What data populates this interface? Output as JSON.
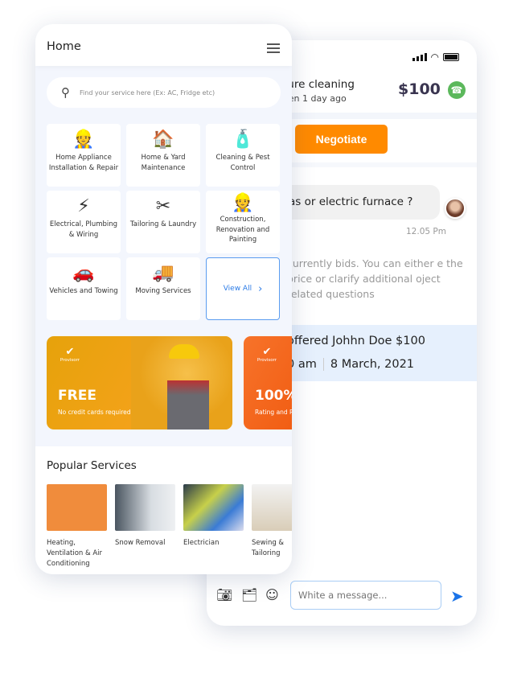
{
  "chat": {
    "job_title": "ture  cleaning",
    "last_seen": "een 1 day ago",
    "price": "$100",
    "negotiate_label": "Negotiate",
    "message": "as or electric furnace ?",
    "message_time": "12.05 Pm",
    "system_text": "currently bids. You can either e the price or clarify additional oject related questions",
    "offer_text": "offered Johhn Doe $100",
    "offer_time": "0 am",
    "offer_date": "8 March, 2021",
    "input_placeholder": "White a message...",
    "colors": {
      "accent": "#ff8a00",
      "call": "#5cb85c",
      "send": "#1a73e8",
      "offer_bg": "#e6f0fd"
    }
  },
  "home": {
    "title": "Home",
    "search_placeholder": "Find your service here (Ex: AC, Fridge etc)",
    "categories": [
      {
        "label": "Home Appliance Installation & Repair",
        "icon": "repairman-icon"
      },
      {
        "label": "Home & Yard Maintenance",
        "icon": "house-icon"
      },
      {
        "label": "Cleaning & Pest Control",
        "icon": "sprayer-icon"
      },
      {
        "label": "Electrical, Plumbing & Wiring",
        "icon": "electrician-icon"
      },
      {
        "label": "Tailoring & Laundry",
        "icon": "tailor-icon"
      },
      {
        "label": "Construction, Renovation and  Painting",
        "icon": "builder-icon"
      },
      {
        "label": "Vehicles and Towing",
        "icon": "car-wash-icon"
      },
      {
        "label": "Moving Services",
        "icon": "moving-truck-icon"
      }
    ],
    "view_all": "View All",
    "banners": [
      {
        "brand": "Provisorr",
        "headline": "FREE",
        "sub": "No credit cards required"
      },
      {
        "brand": "Provisorr",
        "headline": "100%",
        "sub": "Rating and R"
      }
    ],
    "popular_title": "Popular Services",
    "popular": [
      {
        "label": "Heating, Ventilation & Air Conditioning"
      },
      {
        "label": "Snow Removal"
      },
      {
        "label": "Electrician"
      },
      {
        "label": "Sewing & Tailoring"
      }
    ]
  }
}
